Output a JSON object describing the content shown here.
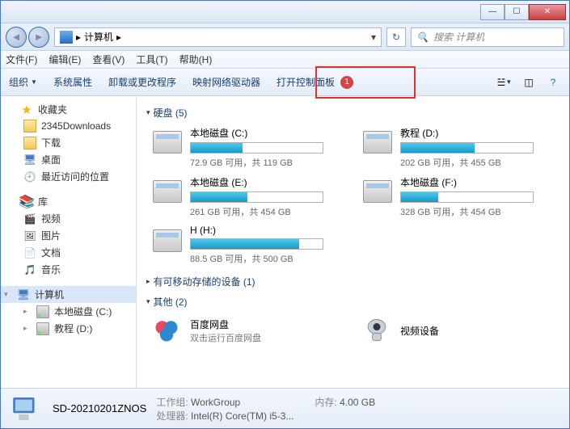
{
  "titlebar": {
    "min": "—",
    "max": "☐",
    "close": "✕"
  },
  "address": {
    "root": "计算机",
    "sep": "▸",
    "dropdown": "▾",
    "refresh": "↻"
  },
  "search": {
    "placeholder": "搜索 计算机",
    "icon": "🔍"
  },
  "menu": {
    "file": "文件(F)",
    "edit": "编辑(E)",
    "view": "查看(V)",
    "tools": "工具(T)",
    "help": "帮助(H)"
  },
  "toolbar": {
    "organize": "组织",
    "props": "系统属性",
    "uninstall": "卸载或更改程序",
    "netdrive": "映射网络驱动器",
    "cpanel": "打开控制面板",
    "badge": "1"
  },
  "sidebar": {
    "fav": "收藏夹",
    "fav_items": [
      "2345Downloads",
      "下载",
      "桌面",
      "最近访问的位置"
    ],
    "lib": "库",
    "lib_items": [
      "视频",
      "图片",
      "文档",
      "音乐"
    ],
    "computer": "计算机",
    "comp_items": [
      "本地磁盘 (C:)",
      "教程 (D:)"
    ]
  },
  "sections": {
    "drives_head": "硬盘 (5)",
    "removable_head": "有可移动存储的设备 (1)",
    "other_head": "其他 (2)"
  },
  "drives": [
    {
      "name": "本地磁盘 (C:)",
      "stat": "72.9 GB 可用，共 119 GB",
      "pct": 39
    },
    {
      "name": "教程 (D:)",
      "stat": "202 GB 可用，共 455 GB",
      "pct": 56
    },
    {
      "name": "本地磁盘 (E:)",
      "stat": "261 GB 可用，共 454 GB",
      "pct": 43
    },
    {
      "name": "本地磁盘 (F:)",
      "stat": "328 GB 可用，共 454 GB",
      "pct": 28
    },
    {
      "name": "H (H:)",
      "stat": "88.5 GB 可用，共 500 GB",
      "pct": 82
    }
  ],
  "other": [
    {
      "name": "百度网盘",
      "sub": "双击运行百度网盘"
    },
    {
      "name": "视频设备",
      "sub": ""
    }
  ],
  "status": {
    "name": "SD-20210201ZNOS",
    "workgroup_lbl": "工作组:",
    "workgroup": "WorkGroup",
    "cpu_lbl": "处理器:",
    "cpu": "Intel(R) Core(TM) i5-3...",
    "mem_lbl": "内存:",
    "mem": "4.00 GB"
  }
}
